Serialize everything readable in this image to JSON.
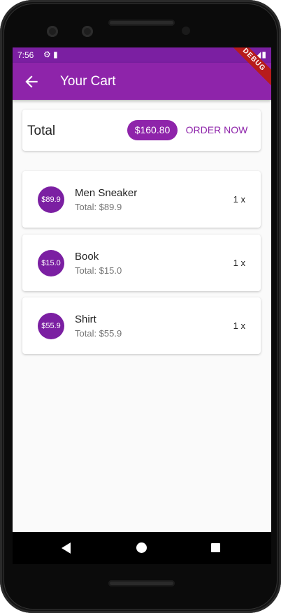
{
  "status_bar": {
    "time": "7:56",
    "left_icons": "⚙ ▮",
    "right_icons": "▾◢▮"
  },
  "app_bar": {
    "title": "Your Cart",
    "back_icon": "arrow-left-icon"
  },
  "debug_banner": "DEBUG",
  "summary": {
    "label": "Total",
    "amount": "$160.80",
    "order_button": "ORDER NOW"
  },
  "items": [
    {
      "price_badge": "$89.9",
      "name": "Men Sneaker",
      "subtitle": "Total: $89.9",
      "quantity": "1 x"
    },
    {
      "price_badge": "$15.0",
      "name": "Book",
      "subtitle": "Total: $15.0",
      "quantity": "1 x"
    },
    {
      "price_badge": "$55.9",
      "name": "Shirt",
      "subtitle": "Total: $55.9",
      "quantity": "1 x"
    }
  ],
  "colors": {
    "primary": "#8e24aa",
    "primary_dark": "#7b1fa2",
    "accent_text": "#8e24aa"
  }
}
